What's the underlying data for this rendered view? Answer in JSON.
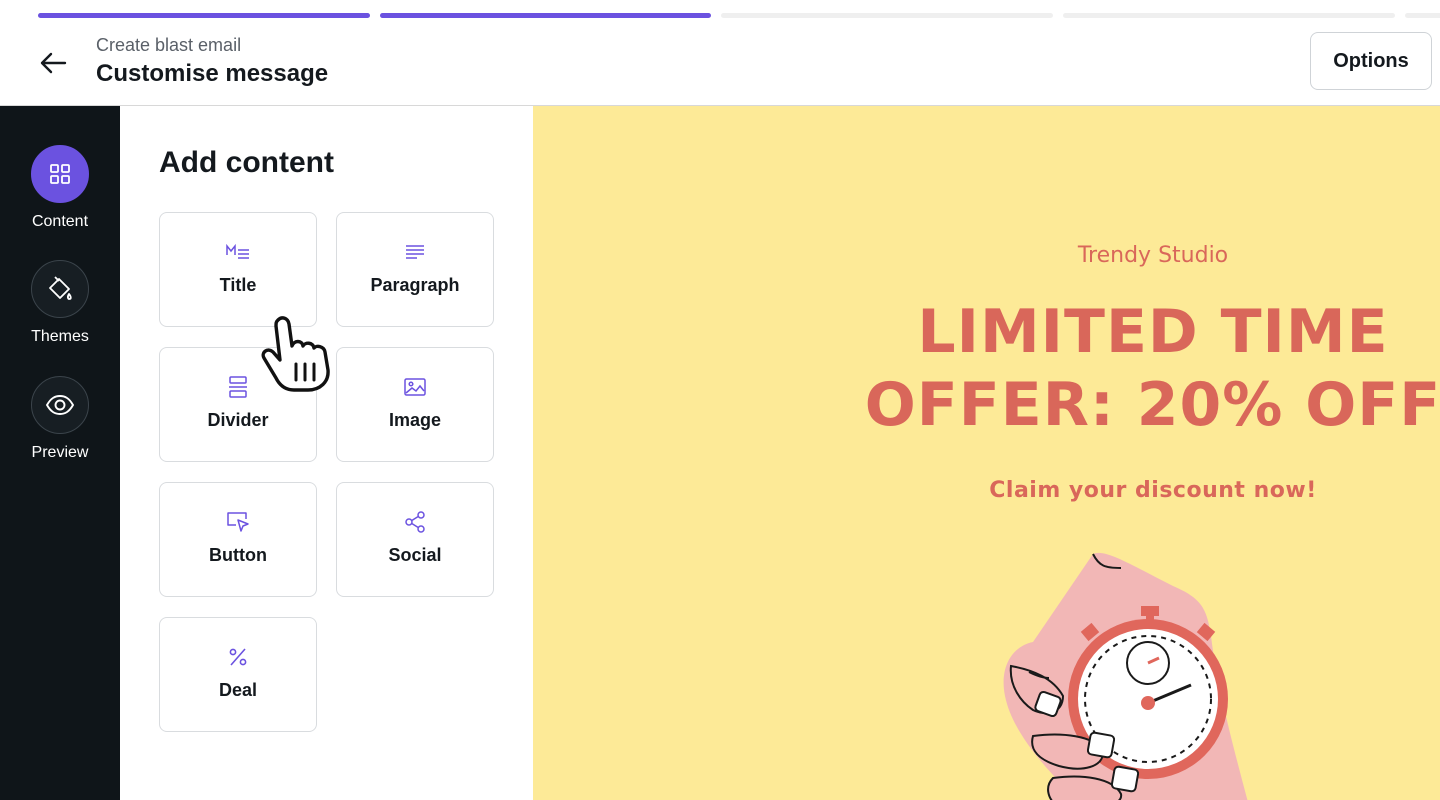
{
  "progress": {
    "total_steps": 5,
    "completed_steps": 2
  },
  "header": {
    "breadcrumb": "Create blast email",
    "title": "Customise message",
    "options_label": "Options"
  },
  "rail": {
    "items": [
      {
        "label": "Content",
        "icon": "grid-icon",
        "active": true
      },
      {
        "label": "Themes",
        "icon": "paint-bucket-icon",
        "active": false
      },
      {
        "label": "Preview",
        "icon": "eye-icon",
        "active": false
      }
    ]
  },
  "panel": {
    "title": "Add content",
    "tiles": [
      {
        "label": "Title",
        "icon": "markdown-title-icon"
      },
      {
        "label": "Paragraph",
        "icon": "paragraph-lines-icon"
      },
      {
        "label": "Divider",
        "icon": "divider-icon"
      },
      {
        "label": "Image",
        "icon": "image-icon"
      },
      {
        "label": "Button",
        "icon": "button-cursor-icon"
      },
      {
        "label": "Social",
        "icon": "share-icon"
      },
      {
        "label": "Deal",
        "icon": "percent-icon"
      }
    ]
  },
  "email": {
    "brand": "Trendy Studio",
    "headline_line1": "LIMITED TIME",
    "headline_line2": "OFFER: 20% OFF",
    "subheadline": "Claim your discount now!"
  },
  "colors": {
    "accent": "#6b52e0",
    "rail_bg": "#0f1519",
    "email_bg": "#fdea97",
    "email_text": "#d9675a"
  }
}
